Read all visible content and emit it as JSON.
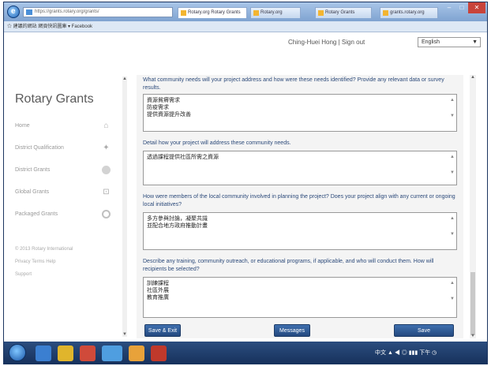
{
  "browser": {
    "address": "https://grants.rotary.org/grants/",
    "tabs": [
      {
        "label": "Rotary.org Rotary Grants",
        "active": true
      },
      {
        "label": "Rotary.org",
        "active": false
      },
      {
        "label": "Rotary Grants",
        "active": false
      },
      {
        "label": "grants.rotary.org",
        "active": false
      }
    ],
    "favorites": "☆ 建議的網站   網頁快訊圖庫 ▾   Facebook"
  },
  "header": {
    "user_text": "Ching-Huei Hong | Sign out",
    "language": "English"
  },
  "sidebar": {
    "logo": "Rotary Grants",
    "items": [
      {
        "label": "Home",
        "icon": "home-icon",
        "glyph": "⌂"
      },
      {
        "label": "District Qualification",
        "icon": "pin-icon",
        "glyph": "✦"
      },
      {
        "label": "District Grants",
        "icon": "district-grants-icon",
        "glyph": ""
      },
      {
        "label": "Global Grants",
        "icon": "global-grants-icon",
        "glyph": "⊡"
      },
      {
        "label": "Packaged Grants",
        "icon": "packaged-grants-icon",
        "glyph": ""
      }
    ],
    "footer": [
      "© 2013 Rotary International",
      "Privacy  Terms  Help",
      "Support"
    ]
  },
  "form": {
    "questions": [
      {
        "label": "What community needs will your project address and how were these needs identified? Provide any relevant data or survey results.",
        "lines": [
          "資源貧瘠需求",
          "防疫需求",
          "提供資源提升改善"
        ]
      },
      {
        "label": "Detail how your project will address these community needs.",
        "lines": [
          "透過課程提供社區所需之資源"
        ]
      },
      {
        "label": "How were members of the local community involved in planning the project? Does your project align with any current or ongoing local initiatives?",
        "lines": [
          "多方參與討論，凝聚共識",
          "並配合地方政府推動計畫"
        ]
      },
      {
        "label": "Describe any training, community outreach, or educational programs, if applicable, and who will conduct them. How will recipients be selected?",
        "lines": [
          "訓練課程",
          "社區外展",
          "教育推廣"
        ]
      }
    ],
    "buttons": {
      "save_exit": "Save & Exit",
      "messages": "Messages",
      "save": "Save"
    }
  },
  "taskbar": {
    "tray_text": "中文 ▲ ◀ ◎ ▮▮▮ 下午 ◷"
  },
  "colors": {
    "question_text": "#2c4a7a",
    "button_blue": "#2f5a96",
    "panel_bg": "#f4f4f4"
  }
}
